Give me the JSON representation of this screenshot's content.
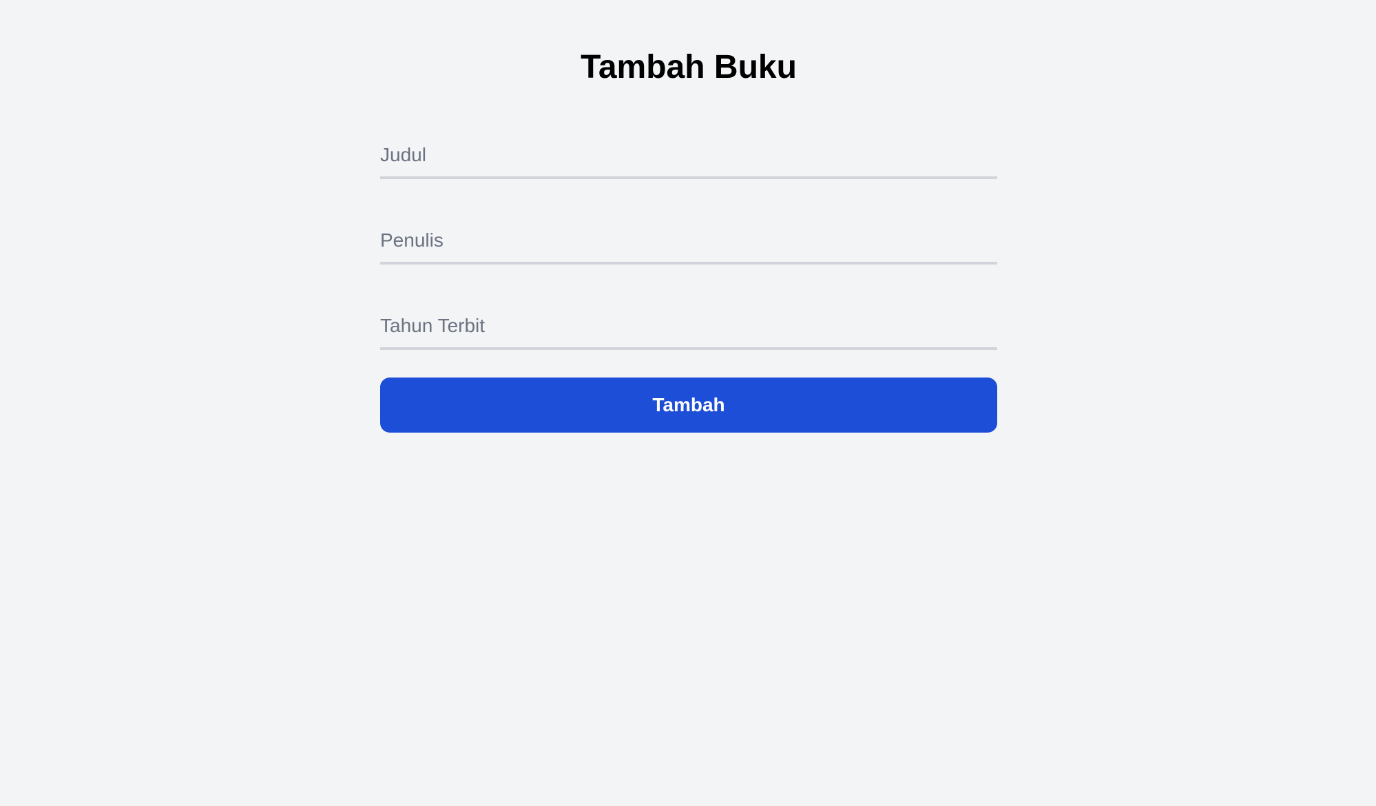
{
  "page": {
    "title": "Tambah Buku"
  },
  "form": {
    "fields": {
      "judul": {
        "placeholder": "Judul",
        "value": ""
      },
      "penulis": {
        "placeholder": "Penulis",
        "value": ""
      },
      "tahun_terbit": {
        "placeholder": "Tahun Terbit",
        "value": ""
      }
    },
    "submit_label": "Tambah"
  },
  "colors": {
    "background": "#f3f4f6",
    "accent": "#1d4ed8",
    "input_border": "#d1d5db",
    "placeholder": "#6b7280"
  }
}
